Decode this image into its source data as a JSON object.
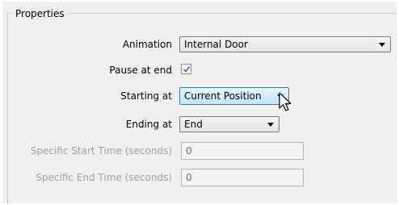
{
  "group": {
    "title": "Properties"
  },
  "fields": {
    "animation": {
      "label": "Animation",
      "value": "Internal Door"
    },
    "pause_at_end": {
      "label": "Pause at end",
      "checked": true
    },
    "starting_at": {
      "label": "Starting at",
      "value": "Current Position"
    },
    "ending_at": {
      "label": "Ending at",
      "value": "End"
    },
    "specific_start": {
      "label": "Specific Start Time (seconds)",
      "value": "0"
    },
    "specific_end": {
      "label": "Specific End Time (seconds)",
      "value": "0"
    }
  },
  "icons": {
    "dropdown": "chevron-down-icon",
    "check": "checkmark-icon",
    "cursor": "mouse-pointer-icon"
  },
  "colors": {
    "panel_bg": "#f0f0f0",
    "disabled_text": "#a0a0a0",
    "focus_border": "#3c7fb1",
    "check_mark": "#4a6fb0"
  }
}
